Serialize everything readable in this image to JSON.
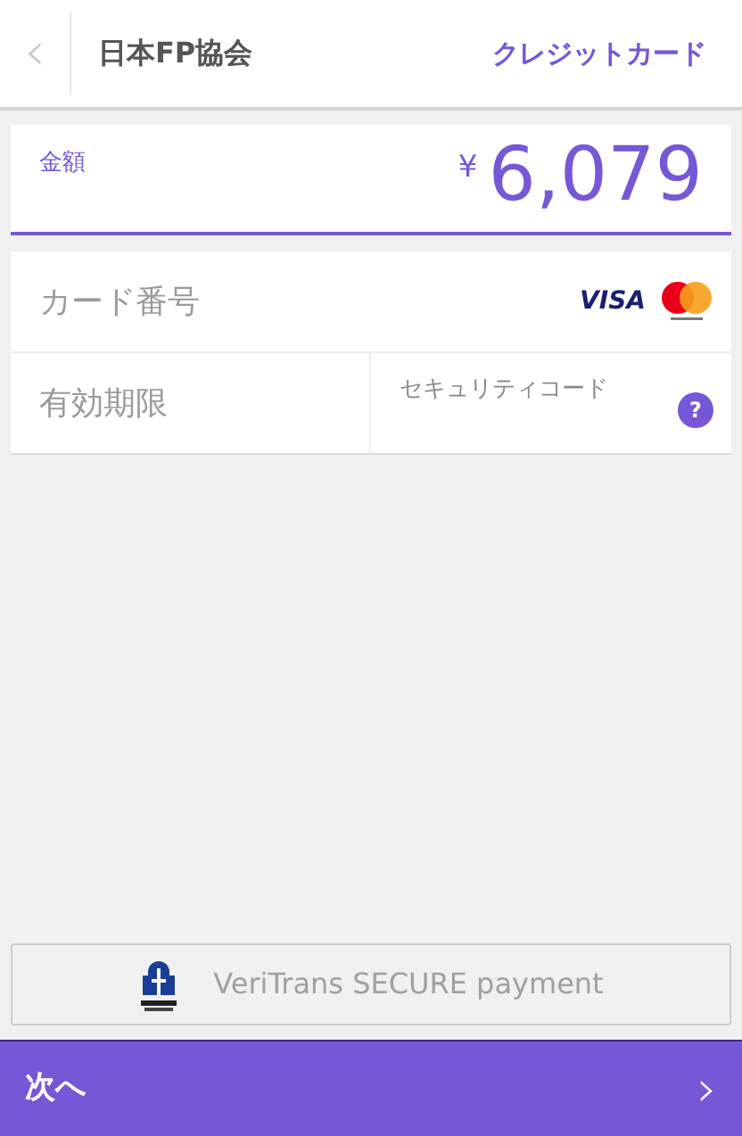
{
  "header": {
    "back": "‹",
    "title": "日本FP協会",
    "method": "クレジットカード"
  },
  "amount": {
    "label": "金額",
    "currency": "¥",
    "value": "6,079"
  },
  "card": {
    "number_placeholder": "カード番号",
    "brand_text": "VISA",
    "expiry_placeholder": "有効期限",
    "cvc_placeholder": "セキュリティコード",
    "help": "?"
  },
  "secure_badge": "VeriTrans SECURE payment",
  "next_button": {
    "label": "次へ",
    "arrow": "›"
  }
}
